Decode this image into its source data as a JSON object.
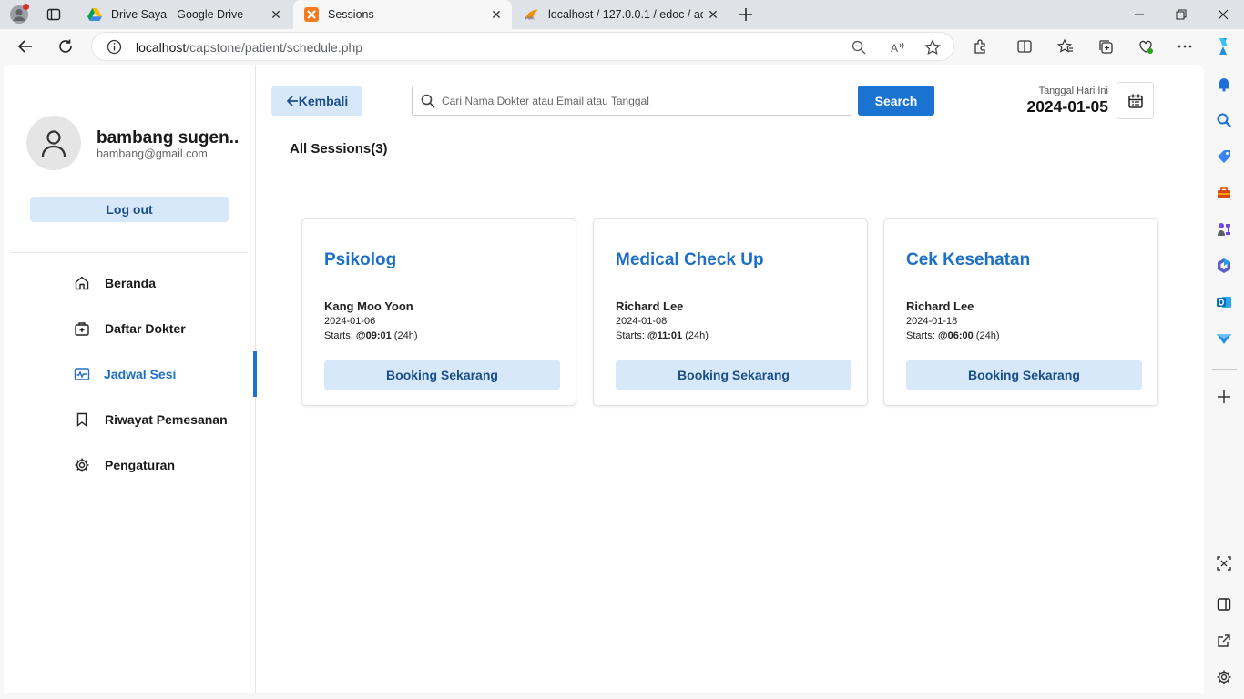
{
  "browser": {
    "tabs": [
      {
        "title": "Drive Saya - Google Drive",
        "active": false
      },
      {
        "title": "Sessions",
        "active": true
      },
      {
        "title": "localhost / 127.0.0.1 / edoc / adr",
        "active": false
      }
    ],
    "url_host": "localhost",
    "url_path": "/capstone/patient/schedule.php"
  },
  "profile": {
    "name": "bambang sugen..",
    "email": "bambang@gmail.com",
    "logout_label": "Log out"
  },
  "menu": {
    "items": [
      {
        "label": "Beranda",
        "icon": "home-icon"
      },
      {
        "label": "Daftar Dokter",
        "icon": "medical-bag-icon"
      },
      {
        "label": "Jadwal Sesi",
        "icon": "schedule-icon",
        "active": true
      },
      {
        "label": "Riwayat Pemesanan",
        "icon": "bookmark-icon"
      },
      {
        "label": "Pengaturan",
        "icon": "gear-icon"
      }
    ]
  },
  "header": {
    "back_label": "Kembali",
    "search_placeholder": "Cari Nama Dokter atau Email atau Tanggal",
    "search_button": "Search",
    "date_caption": "Tanggal Hari Ini",
    "date_value": "2024-01-05"
  },
  "sessions": {
    "heading": "All Sessions(3)",
    "cards": [
      {
        "title": "Psikolog",
        "doctor": "Kang Moo Yoon",
        "date": "2024-01-06",
        "starts_label": "Starts:",
        "time": "@09:01",
        "time_suffix": "(24h)",
        "button": "Booking Sekarang"
      },
      {
        "title": "Medical Check Up",
        "doctor": "Richard Lee",
        "date": "2024-01-08",
        "starts_label": "Starts:",
        "time": "@11:01",
        "time_suffix": "(24h)",
        "button": "Booking Sekarang"
      },
      {
        "title": "Cek Kesehatan",
        "doctor": "Richard Lee",
        "date": "2024-01-18",
        "starts_label": "Starts:",
        "time": "@06:00",
        "time_suffix": "(24h)",
        "button": "Booking Sekarang"
      }
    ]
  },
  "colors": {
    "accent": "#1a73d0",
    "accent_light": "#d6e8fa",
    "title_blue": "#1e6fc7"
  }
}
